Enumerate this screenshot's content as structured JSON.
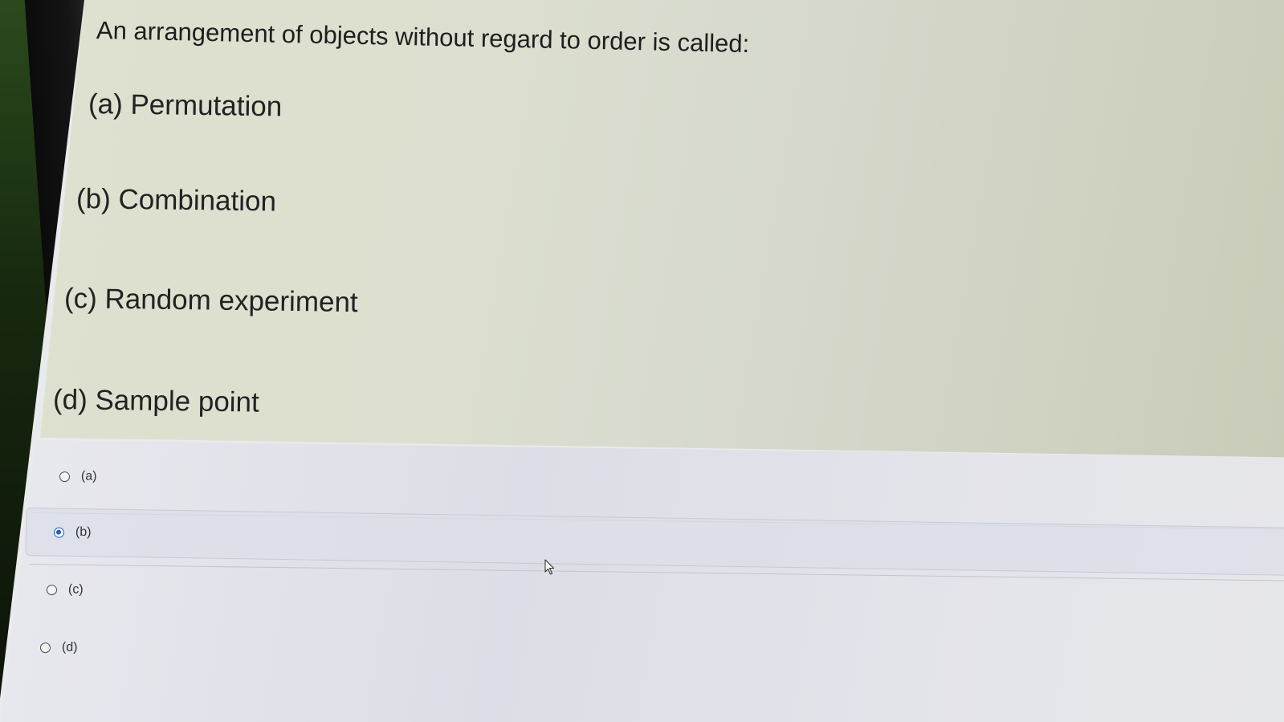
{
  "question": {
    "text": "An arrangement of objects without regard to order is called:",
    "options": [
      {
        "text": "(a) Permutation"
      },
      {
        "text": "(b) Combination"
      },
      {
        "text": "(c) Random experiment"
      },
      {
        "text": "(d) Sample point"
      }
    ]
  },
  "answers": [
    {
      "label": "(a)",
      "selected": false
    },
    {
      "label": "(b)",
      "selected": true
    },
    {
      "label": "(c)",
      "selected": false
    },
    {
      "label": "(d)",
      "selected": false
    }
  ],
  "colors": {
    "accent": "#1a5fd0",
    "topbar": "#1b4f9c"
  },
  "icons": {
    "cursor": "mouse-pointer-icon"
  }
}
